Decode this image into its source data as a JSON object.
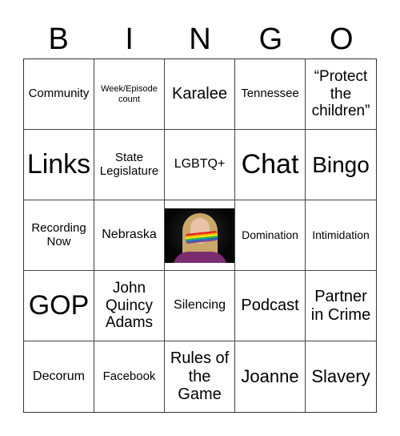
{
  "header": {
    "letters": [
      "B",
      "I",
      "N",
      "G",
      "O"
    ]
  },
  "cells": [
    "Community",
    "Week/Episode count",
    "Karalee",
    "Tennessee",
    "“Protect the children”",
    "Links",
    "State Legislature",
    "LGBTQ+",
    "Chat",
    "Bingo",
    "Recording Now",
    "Nebraska",
    "",
    "Domination",
    "Intimidation",
    "GOP",
    "John Quincy Adams",
    "Silencing",
    "Podcast",
    "Partner in Crime",
    "Decorum",
    "Facebook",
    "Rules of the Game",
    "Joanne",
    "Slavery"
  ],
  "free_space": {
    "image": "woman-with-rainbow-gag-photo"
  }
}
